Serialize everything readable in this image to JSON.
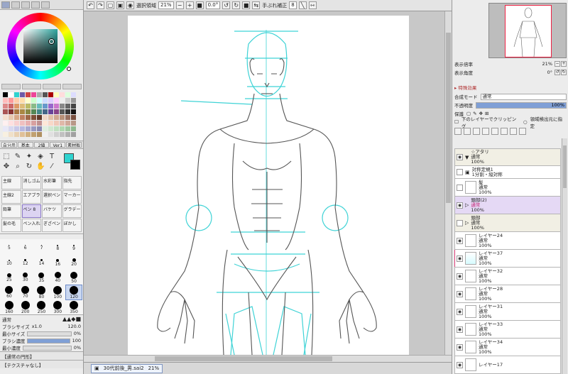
{
  "toolbar": {
    "selection_label": "選択領域",
    "zoom": "21%",
    "angle": "0.0°",
    "stabilizer_label": "手ぶれ補正",
    "stabilizer_value": "8"
  },
  "swatches": [
    "#000",
    "#fff",
    "#2fd3cf",
    "#6d5aa8",
    "#c44",
    "#e49",
    "#aaa",
    "#555",
    "#a00",
    "#ffb",
    "#fdd",
    "#dfd",
    "#ddf",
    "#fbb",
    "#f99",
    "#fca",
    "#fda",
    "#ffc",
    "#cfc",
    "#cff",
    "#cdf",
    "#dcf",
    "#fcf",
    "#eee",
    "#ccc",
    "#999",
    "#d88",
    "#c66",
    "#d96",
    "#db7",
    "#bb6",
    "#8b8",
    "#6bb",
    "#69c",
    "#96c",
    "#c7c",
    "#888",
    "#666",
    "#444",
    "#a55",
    "#833",
    "#a74",
    "#a84",
    "#884",
    "#585",
    "#488",
    "#468",
    "#649",
    "#848",
    "#555",
    "#333",
    "#111",
    "#f5e0d0",
    "#e8c8b0",
    "#d8a888",
    "#c08060",
    "#a06848",
    "#805038",
    "#603828",
    "#f0d8c8",
    "#e0c0a8",
    "#d0a890",
    "#b89078",
    "#987060",
    "#785040",
    "#fff0f0",
    "#ffe0e0",
    "#f8d0d0",
    "#f0c0c0",
    "#e8b0b0",
    "#d8a0a0",
    "#c09090",
    "#ffe8d8",
    "#f8d8c8",
    "#f0c8b8",
    "#e0b8a8",
    "#d0a898",
    "#b89888",
    "#e8e8f8",
    "#d8d8f0",
    "#c8c8e8",
    "#b8b8e0",
    "#a8a8d0",
    "#9898c0",
    "#8888b0",
    "#e0f0e0",
    "#d0e8d0",
    "#c0e0c0",
    "#b0d8b0",
    "#a0c8a0",
    "#90b890",
    "#f8f0e0",
    "#f0e0c8",
    "#e8d0b0",
    "#e0c098",
    "#d0b080",
    "#c0a070",
    "#b09060",
    "#f0f0f0",
    "#e0e0e0",
    "#d0d0d0",
    "#c0c0c0",
    "#b0b0b0",
    "#a0a0a0"
  ],
  "tool_tabs": [
    "自分用",
    "基本",
    "2値",
    "Ver1",
    "素材板"
  ],
  "brushes": [
    {
      "name": "主線"
    },
    {
      "name": "消しゴム"
    },
    {
      "name": "水彩筆"
    },
    {
      "name": "指先"
    },
    {
      "name": "主線2"
    },
    {
      "name": "エアブラシ"
    },
    {
      "name": "選択ペン"
    },
    {
      "name": "マーカー"
    },
    {
      "name": "鉛筆"
    },
    {
      "name": "ペン 8"
    },
    {
      "name": "バケツ"
    },
    {
      "name": "グラデーション"
    },
    {
      "name": "髪の毛"
    },
    {
      "name": "ペン入れ"
    },
    {
      "name": "ぎざペン"
    },
    {
      "name": "ぼかし"
    }
  ],
  "brush_sizes": [
    {
      "label": "5",
      "d": 1
    },
    {
      "label": "6",
      "d": 1
    },
    {
      "label": "7",
      "d": 1
    },
    {
      "label": "8",
      "d": 2
    },
    {
      "label": "9",
      "d": 2
    },
    {
      "label": "10",
      "d": 2
    },
    {
      "label": "12",
      "d": 3
    },
    {
      "label": "14",
      "d": 3
    },
    {
      "label": "16",
      "d": 4
    },
    {
      "label": "20",
      "d": 5
    },
    {
      "label": "25",
      "d": 6
    },
    {
      "label": "30",
      "d": 7
    },
    {
      "label": "35",
      "d": 8
    },
    {
      "label": "40",
      "d": 9
    },
    {
      "label": "50",
      "d": 10
    },
    {
      "label": "60",
      "d": 11
    },
    {
      "label": "70",
      "d": 11
    },
    {
      "label": "80",
      "d": 12
    },
    {
      "label": "100",
      "d": 12
    },
    {
      "label": "120",
      "d": 12
    },
    {
      "label": "160",
      "d": 12
    },
    {
      "label": "200",
      "d": 12
    },
    {
      "label": "250",
      "d": 12
    },
    {
      "label": "300",
      "d": 12
    },
    {
      "label": "350",
      "d": 12
    }
  ],
  "brush_params": {
    "shape_label": "通常",
    "size_label": "ブラシサイズ",
    "size_mult": "x1.0",
    "size_value": "120.0",
    "min_size_label": "最小サイズ",
    "min_size_value": "0%",
    "density_label": "ブラシ濃度",
    "density_value": "100",
    "min_density_label": "最小濃度",
    "min_density_value": "0%",
    "density_fill": 1.0
  },
  "bottom_items": [
    "【通常の円形】",
    "【テクスチャなし】"
  ],
  "file_tab": {
    "name": "30代前後_男.sai2",
    "zoom": "21%"
  },
  "navigator": {
    "zoom_label": "表示倍率",
    "zoom_value": "21%",
    "angle_label": "表示角度",
    "angle_value": "0°"
  },
  "effects_header": "特殊効果",
  "layer_props": {
    "blend_label": "合成モード",
    "blend_value": "通常",
    "opacity_label": "不透明度",
    "opacity_value": "100%",
    "protect_label": "保護",
    "clip_label": "下のレイヤーでクリッピング",
    "detect_label": "領域検出元に指定"
  },
  "layers": [
    {
      "name": "☆アタリ",
      "mode": "通常",
      "opacity": "100%",
      "type": "folder",
      "open": true
    },
    {
      "name": "対称定規1",
      "mode": "1分割・縦対称",
      "opacity": "",
      "type": "ruler"
    },
    {
      "name": "髪",
      "mode": "通常",
      "opacity": "100%",
      "type": "layer"
    },
    {
      "name": "頭部(2)",
      "mode": "通常",
      "opacity": "100%",
      "type": "folder-sel",
      "pink": true
    },
    {
      "name": "頭部",
      "mode": "通常",
      "opacity": "100%",
      "type": "folder"
    },
    {
      "name": "レイヤー24",
      "mode": "通常",
      "opacity": "100%",
      "type": "layer"
    },
    {
      "name": "レイヤー37",
      "mode": "通常",
      "opacity": "100%",
      "type": "layer",
      "flag": true,
      "cyan": true
    },
    {
      "name": "レイヤー32",
      "mode": "通常",
      "opacity": "100%",
      "type": "layer"
    },
    {
      "name": "レイヤー28",
      "mode": "通常",
      "opacity": "100%",
      "type": "layer"
    },
    {
      "name": "レイヤー31",
      "mode": "通常",
      "opacity": "100%",
      "type": "layer"
    },
    {
      "name": "レイヤー33",
      "mode": "通常",
      "opacity": "100%",
      "type": "layer"
    },
    {
      "name": "レイヤー34",
      "mode": "通常",
      "opacity": "100%",
      "type": "layer"
    },
    {
      "name": "レイヤー17",
      "mode": "",
      "opacity": "",
      "type": "layer"
    }
  ]
}
